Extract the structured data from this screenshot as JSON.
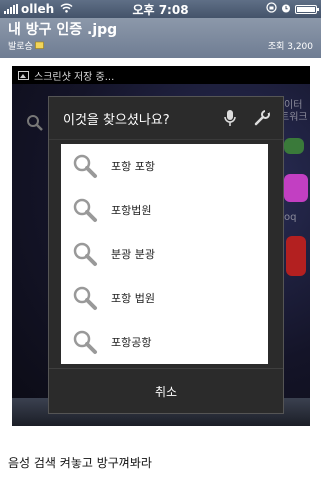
{
  "status_bar": {
    "carrier": "olleh",
    "time": "오후 7:08"
  },
  "post": {
    "title": "내 방구 인증 .jpg",
    "author": "발로승",
    "views": "조회 3,200"
  },
  "screenshot": {
    "status_text": "스크린샷 저장 중...",
    "background_labels": [
      "이터",
      "트워크",
      "oq"
    ],
    "voice_dialog": {
      "title": "이것을 찾으셨나요?",
      "suggestions": [
        "포항 포항",
        "포항법원",
        "분광 분광",
        "포항 법원",
        "포항공항"
      ],
      "cancel_label": "취소"
    }
  },
  "caption": "음성 검색 켜놓고 방구껴봐라"
}
